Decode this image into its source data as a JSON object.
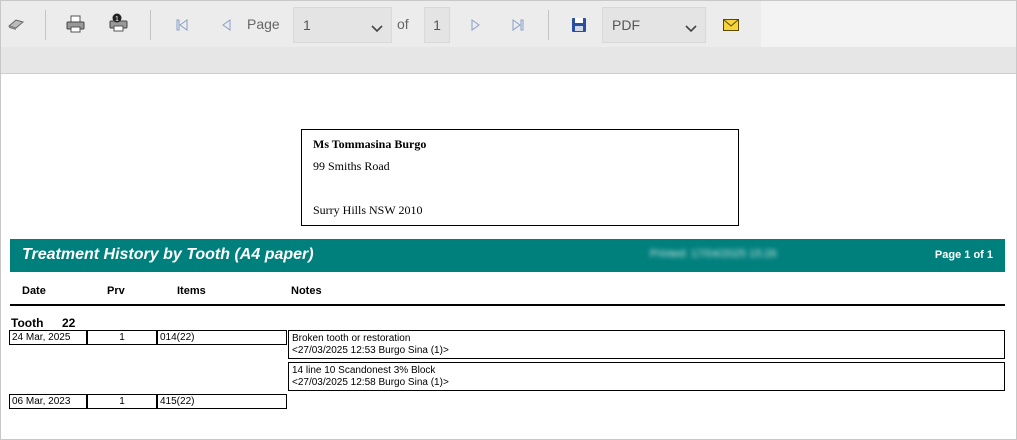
{
  "toolbar": {
    "page_label": "Page",
    "page_value": "1",
    "of_label": "of",
    "total_pages": "1",
    "format_value": "PDF",
    "icons": [
      "eraser-icon",
      "print-icon",
      "print-options-icon",
      "first-page-icon",
      "previous-page-icon",
      "next-page-icon",
      "last-page-icon",
      "save-icon",
      "email-icon"
    ]
  },
  "address": {
    "name": "Ms Tommasina  Burgo",
    "line1": "99 Smiths Road",
    "line2": "Surry Hills NSW 2010"
  },
  "report": {
    "title": "Treatment History by Tooth (A4 paper)",
    "printed": "Printed: 17/04/2025 15:26",
    "page_of": "Page 1 of 1",
    "colors": {
      "header_bg": "#00807d"
    },
    "columns": [
      "Date",
      "Prv",
      "Items",
      "Notes"
    ],
    "tooth_label": "Tooth",
    "tooth_number": "22",
    "rows": [
      {
        "date": "24 Mar, 2025",
        "prv": "1",
        "item": "014(22)"
      },
      {
        "date": "06 Mar, 2023",
        "prv": "1",
        "item": "415(22)"
      }
    ],
    "notes": [
      {
        "line1": "Broken tooth or restoration",
        "line2": "<27/03/2025 12:53 Burgo Sina (1)>"
      },
      {
        "line1": "14 line 10 Scandonest 3% Block",
        "line2": "<27/03/2025 12:58 Burgo Sina (1)>"
      }
    ]
  }
}
